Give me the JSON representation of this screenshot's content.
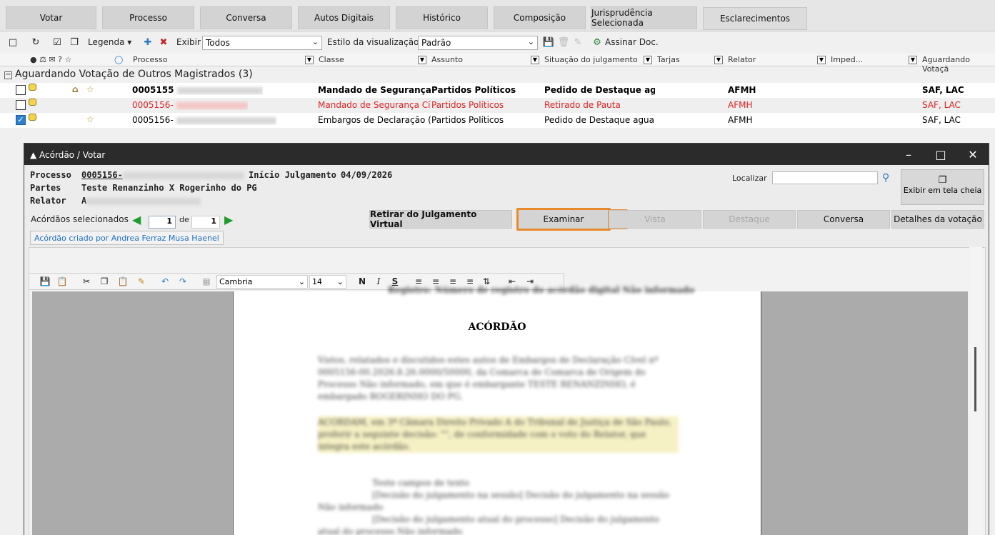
{
  "top_tabs": [
    {
      "label": "Votar"
    },
    {
      "label": "Processo"
    },
    {
      "label": "Conversa"
    },
    {
      "label": "Autos Digitais"
    },
    {
      "label": "Histórico"
    },
    {
      "label": "Composição"
    },
    {
      "label": "Jurisprudência Selecionada"
    },
    {
      "label": "Esclarecimentos"
    }
  ],
  "toolbar": {
    "legenda": "Legenda",
    "exibir_label": "Exibir",
    "exibir_value": "Todos",
    "estilo_label": "Estilo da visualização",
    "estilo_value": "Padrão",
    "assinar": "Assinar Doc."
  },
  "columns": {
    "processo": "Processo",
    "classe": "Classe",
    "assunto": "Assunto",
    "situacao": "Situação do julgamento",
    "tarjas": "Tarjas",
    "relator": "Relator",
    "imped": "Imped...",
    "aguardando": "Aguardando Votaçã"
  },
  "group_title": "Aguardando Votação de Outros Magistrados (3)",
  "rows": [
    {
      "processo": "0005155",
      "classe": "Mandado de Segurança C",
      "assunto": "Partidos Políticos",
      "situacao": "Pedido de Destaque aguar",
      "relator": "AFMH",
      "aguardando": "SAF, LAC"
    },
    {
      "processo": "0005156-",
      "classe": "Mandado de Segurança Cí",
      "assunto": "Partidos Políticos",
      "situacao": "Retirado de Pauta",
      "relator": "AFMH",
      "aguardando": "SAF, LAC"
    },
    {
      "processo": "0005156-",
      "classe": "Embargos de Declaração (",
      "assunto": "Partidos Políticos",
      "situacao": "Pedido de Destaque aguar",
      "relator": "AFMH",
      "aguardando": "SAF, LAC"
    }
  ],
  "dialog": {
    "title": "Acórdão / Votar",
    "processo_label": "Processo",
    "processo_value": "0005156-",
    "inicio_label": "Início Julgamento",
    "inicio_value": "04/09/2026",
    "partes_label": "Partes",
    "partes_value": "Teste Renanzinho X Rogerinho do PG",
    "relator_label": "Relator",
    "relator_value": "A",
    "localizar_label": "Localizar",
    "fullscreen_label": "Exibir em tela cheia",
    "acordaos_label": "Acórdãos selecionados",
    "pager_current": "1",
    "pager_de": "de",
    "pager_total": "1",
    "acord_tab": "Acórdão criado por Andrea Ferraz Musa Haenel",
    "buttons": {
      "retirar": "Retirar do Julgamento Virtual",
      "examinar": "Examinar",
      "vista": "Vista",
      "destaque": "Destaque",
      "conversa": "Conversa",
      "detalhes": "Detalhes da votação"
    },
    "badge": "1"
  },
  "editor": {
    "font": "Cambria",
    "size": "14",
    "doc_heading": "ACÓRDÃO"
  },
  "colors": {
    "highlight": "#e8892b",
    "red_row": "#e02020",
    "arrow": "#1e9d2b",
    "link": "#1f6fc8"
  }
}
